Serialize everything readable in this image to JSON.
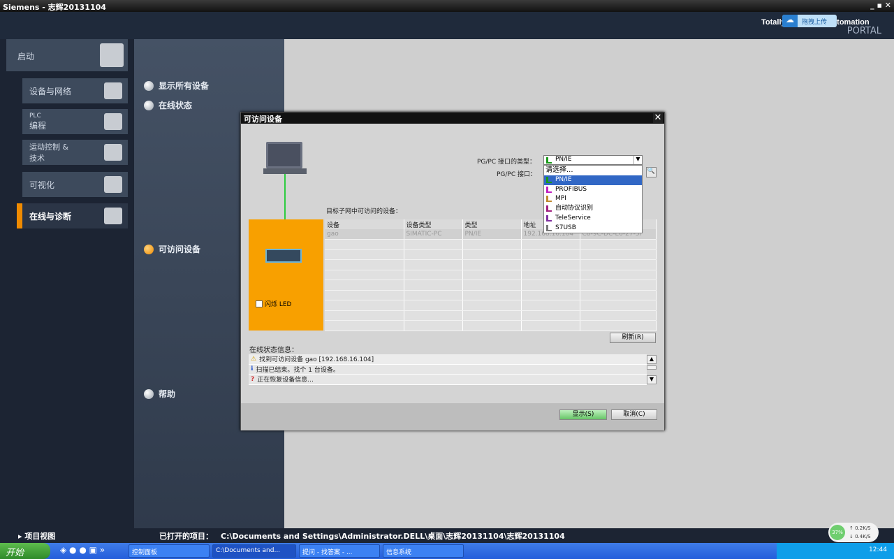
{
  "window": {
    "title": "Siemens - 志辉20131104",
    "brand_line1": "Totally Integrated Automation",
    "brand_line1_visible": "Total        tomation",
    "brand_line2": "PORTAL",
    "upload_label": "拖拽上传"
  },
  "sidebar": {
    "start": "启动",
    "items": [
      {
        "label": "设备与网络"
      },
      {
        "label": "PLC\n编程",
        "l1": "PLC",
        "l2": "编程"
      },
      {
        "label": "运动控制 & 技术",
        "l1": "运动控制 &",
        "l2": "技术"
      },
      {
        "label": "可视化"
      },
      {
        "label": "在线与诊断",
        "active": true
      }
    ],
    "project_view": "项目视图"
  },
  "options": [
    {
      "label": "显示所有设备"
    },
    {
      "label": "在线状态"
    },
    {
      "label": "可访问设备",
      "active": true
    },
    {
      "label": "帮助"
    }
  ],
  "dialog": {
    "title": "可访问设备",
    "iface_type_label": "PG/PC 接口的类型：",
    "iface_label": "PG/PC 接口：",
    "iface_type_value": "PN/IE",
    "dropdown_options": [
      {
        "label": "请选择..."
      },
      {
        "label": "PN/IE",
        "color": "#1a9a1a",
        "selected": true
      },
      {
        "label": "PROFIBUS",
        "color": "#c020c0"
      },
      {
        "label": "MPI",
        "color": "#c08a30"
      },
      {
        "label": "自动协议识别",
        "color": "#a02080"
      },
      {
        "label": "TeleService",
        "color": "#8030a0"
      },
      {
        "label": "S7USB",
        "color": "#777777"
      }
    ],
    "subnet_label": "目标子网中可访问的设备：",
    "flash_led": "闪烁 LED",
    "columns": [
      "设备",
      "设备类型",
      "类型",
      "地址",
      ""
    ],
    "rows": [
      [
        "gao",
        "SIMATIC-PC",
        "PN/IE",
        "192.168.16.104",
        "C8-9C-DC-E6-27-5F"
      ]
    ],
    "refresh": "刷新(R)",
    "status_label": "在线状态信息：",
    "log": [
      {
        "icon": "warning-icon",
        "text": "找到可访问设备 gao [192.168.16.104]"
      },
      {
        "icon": "info-icon",
        "text": "扫描已结束。找个 1 台设备。"
      },
      {
        "icon": "query-icon",
        "text": "正在恢复设备信息..."
      }
    ],
    "show": "显示(S)",
    "cancel": "取消(C)"
  },
  "statusbar": {
    "label": "已打开的项目：",
    "path": "C:\\Documents and Settings\\Administrator.DELL\\桌面\\志辉20131104\\志辉20131104"
  },
  "network": {
    "percent": "37%",
    "up": "0.2K/S",
    "down": "0.4K/S"
  },
  "taskbar": {
    "start": "开始",
    "tasks": [
      "控制面板",
      "C:\\Documents and...",
      "提问 - 找答案 - ...",
      "信息系统"
    ],
    "clock": "12:44"
  }
}
